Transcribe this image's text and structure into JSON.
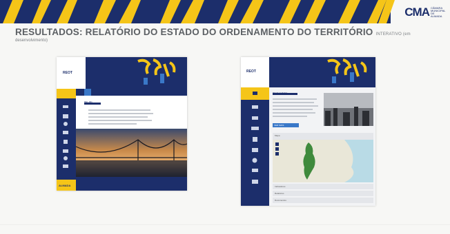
{
  "header": {
    "logo_text": "CMA",
    "logo_subtext": "CÂMARA MUNICIPAL DE ALMADA",
    "colors": {
      "yellow": "#f5c518",
      "navy": "#1c2e6b"
    }
  },
  "slide": {
    "title": "RESULTADOS: RELATÓRIO DO ESTADO DO ORDENAMENTO DO TERRITÓRIO",
    "title_suffix": "INTERATIVO (em",
    "subtitle": "desenvolvimento)"
  },
  "left_screenshot": {
    "brand": "REOT",
    "section_heading": "REL-001",
    "footer_label": "ALMADA",
    "sidebar_icons": [
      "menu-icon",
      "pencil-icon",
      "gear-icon",
      "chart-icon",
      "tree-icon",
      "building-icon",
      "people-icon",
      "map-icon"
    ]
  },
  "right_screenshot": {
    "brand": "REOT",
    "section_heading": "REOT ALMADA",
    "button_label": "VER MAIS",
    "map_panel_label": "Mapa",
    "list_items": [
      "Indicadores",
      "Relatórios",
      "Documentos"
    ],
    "sidebar_icons": [
      "home-icon",
      "pencil-icon",
      "chart-icon",
      "car-icon",
      "tree-icon",
      "building-icon",
      "people-icon",
      "map-icon",
      "grid-icon"
    ]
  }
}
